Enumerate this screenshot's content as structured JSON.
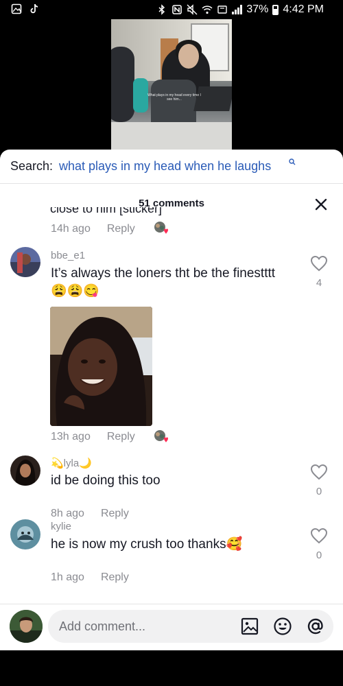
{
  "status_bar": {
    "battery": "37%",
    "time": "4:42 PM"
  },
  "video": {
    "caption": "What plays in my head every time I see him..."
  },
  "search": {
    "prefix": "Search:",
    "query": "what plays in my head when he laughs"
  },
  "comments": {
    "count_label": "51 comments",
    "partial_comment": {
      "text": "close to him [sticker]",
      "time": "14h ago",
      "reply": "Reply"
    },
    "items": [
      {
        "username": "bbe_e1",
        "text": "It’s always the loners tht be the finestttt😩😩😋",
        "likes": "4",
        "time": "13h ago",
        "reply": "Reply",
        "has_image": true
      },
      {
        "username": "💫lyla🌙",
        "text": "id be doing this too",
        "likes": "0",
        "time": "8h ago",
        "reply": "Reply"
      },
      {
        "username": "kylie",
        "text": "he is now my crush too thanks🥰",
        "likes": "0",
        "time": "1h ago",
        "reply": "Reply"
      }
    ]
  },
  "input": {
    "placeholder": "Add comment..."
  },
  "colors": {
    "search_query": "#2a5bb7",
    "secondary_text": "#8a8b91",
    "like_red": "#fe2c55"
  }
}
